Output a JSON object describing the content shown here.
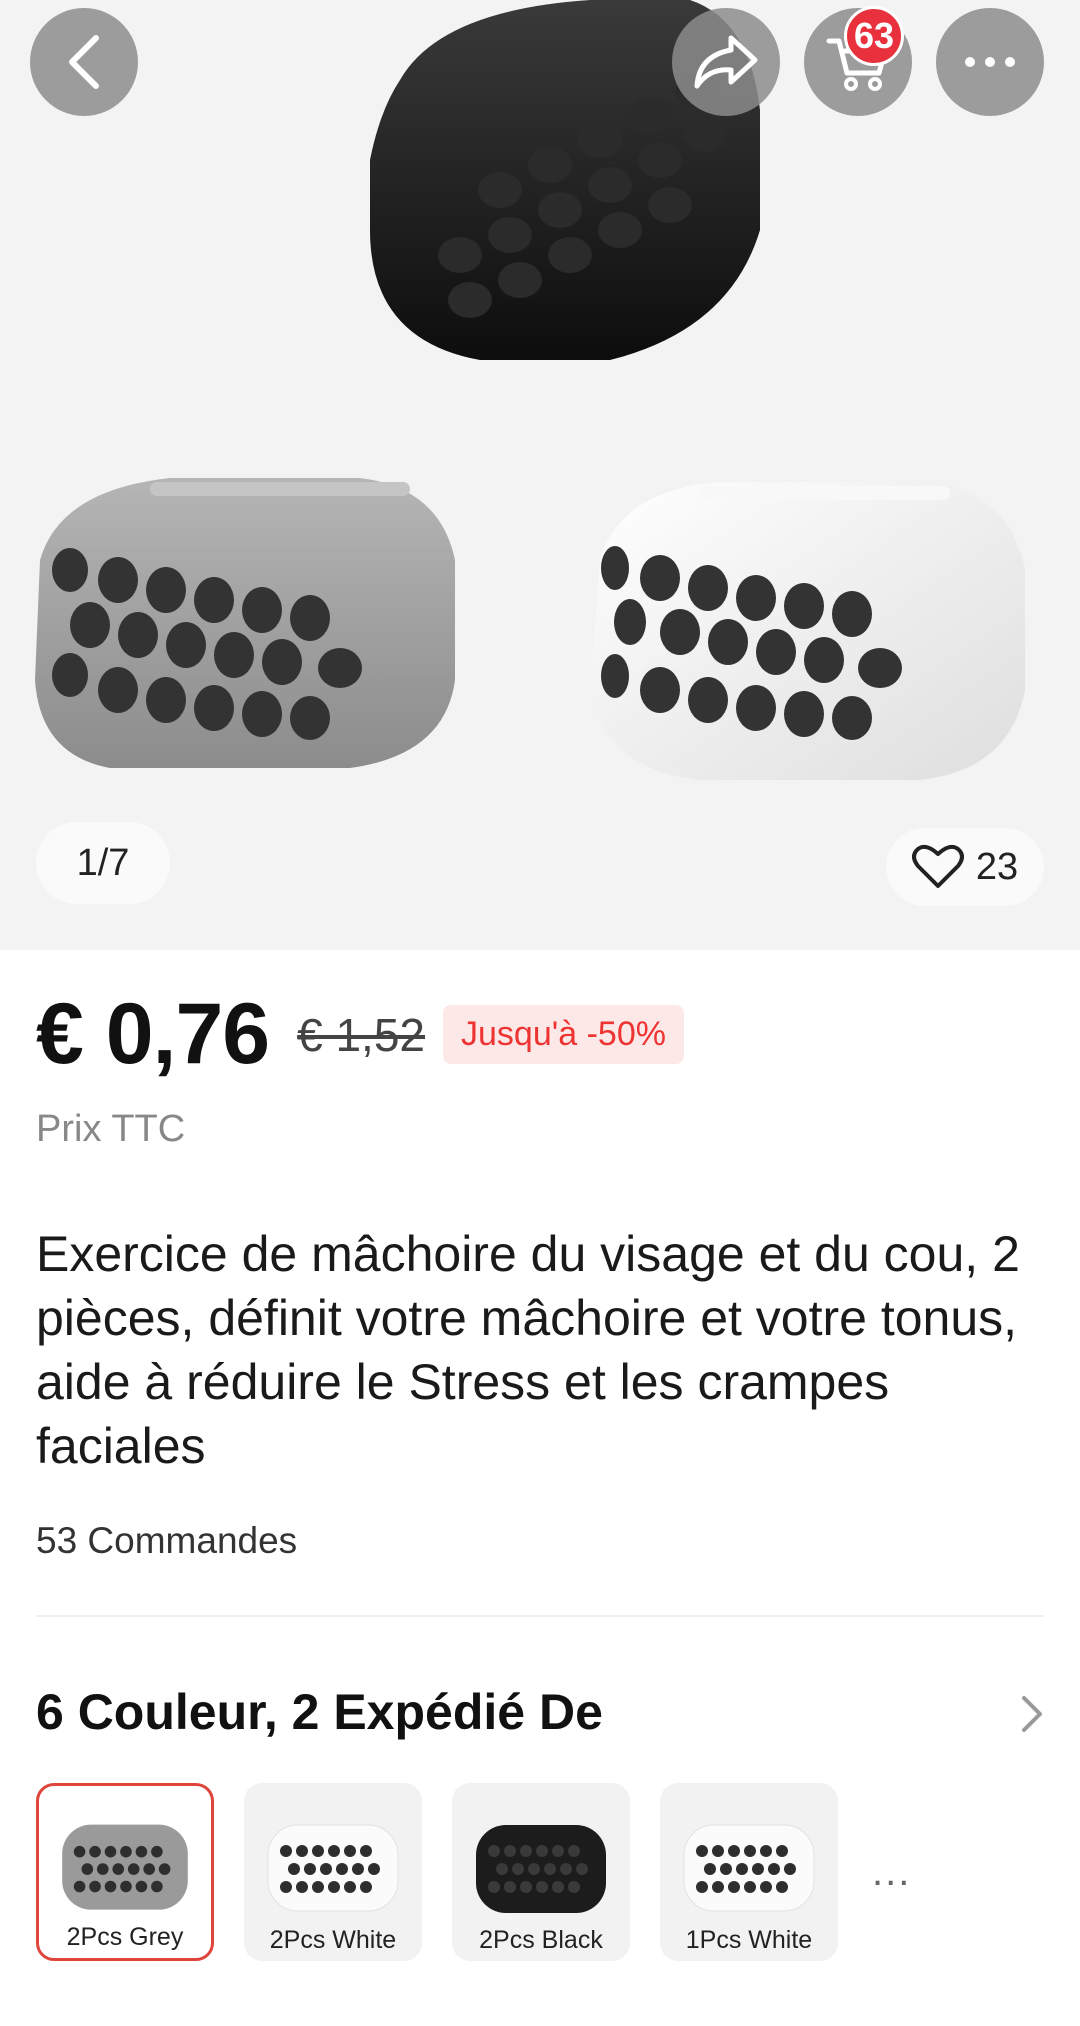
{
  "header": {
    "cart_badge": "63"
  },
  "gallery": {
    "counter": "1/7",
    "likes": "23"
  },
  "price": {
    "current": "€ 0,76",
    "original": "€ 1,52",
    "discount": "Jusqu'à -50%",
    "tax_note": "Prix TTC"
  },
  "product": {
    "title": "Exercice de mâchoire du visage et du cou, 2 pièces, définit votre mâchoire et votre tonus, aide à réduire le Stress et les crampes faciales",
    "orders": "53 Commandes"
  },
  "variants": {
    "heading": "6 Couleur, 2 Expédié De",
    "items": [
      {
        "label": "2Pcs Grey",
        "color": "#9a9a9a"
      },
      {
        "label": "2Pcs White",
        "color": "#f4f4f4"
      },
      {
        "label": "2Pcs Black",
        "color": "#1c1c1c"
      },
      {
        "label": "1Pcs White",
        "color": "#f4f4f4"
      }
    ],
    "more": "..."
  },
  "icons": [
    "back-arrow-icon",
    "share-icon",
    "cart-icon",
    "more-icon",
    "heart-icon",
    "chevron-right-icon"
  ],
  "colors": {
    "badge": "#e8313c",
    "discount_text": "#e33",
    "discount_bg": "#fde8e8",
    "selected_border": "#e0453c"
  }
}
